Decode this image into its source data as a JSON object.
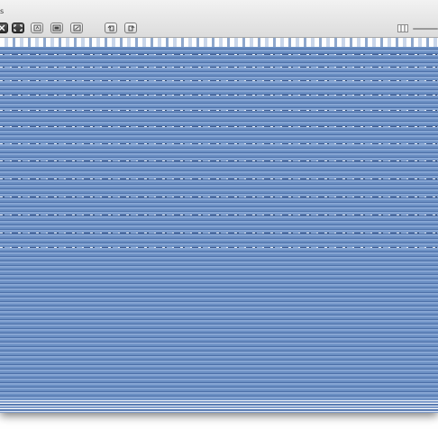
{
  "window": {
    "caption": "s"
  },
  "toolbar": {
    "buttons": [
      {
        "name": "close-button",
        "icon": "close-icon"
      },
      {
        "name": "fit-screen-button",
        "icon": "fullscreen-icon"
      },
      {
        "name": "actual-size-button",
        "icon": "actual-size-icon"
      },
      {
        "name": "slideshow-button",
        "icon": "slideshow-icon"
      },
      {
        "name": "crop-button",
        "icon": "crop-icon"
      },
      {
        "name": "rotate-left-button",
        "icon": "rotate-left-icon"
      },
      {
        "name": "rotate-right-button",
        "icon": "rotate-right-icon"
      }
    ],
    "zoom_icon": "zoom-image-icon"
  },
  "image_viewer": {
    "content": "striped-blue-image"
  }
}
